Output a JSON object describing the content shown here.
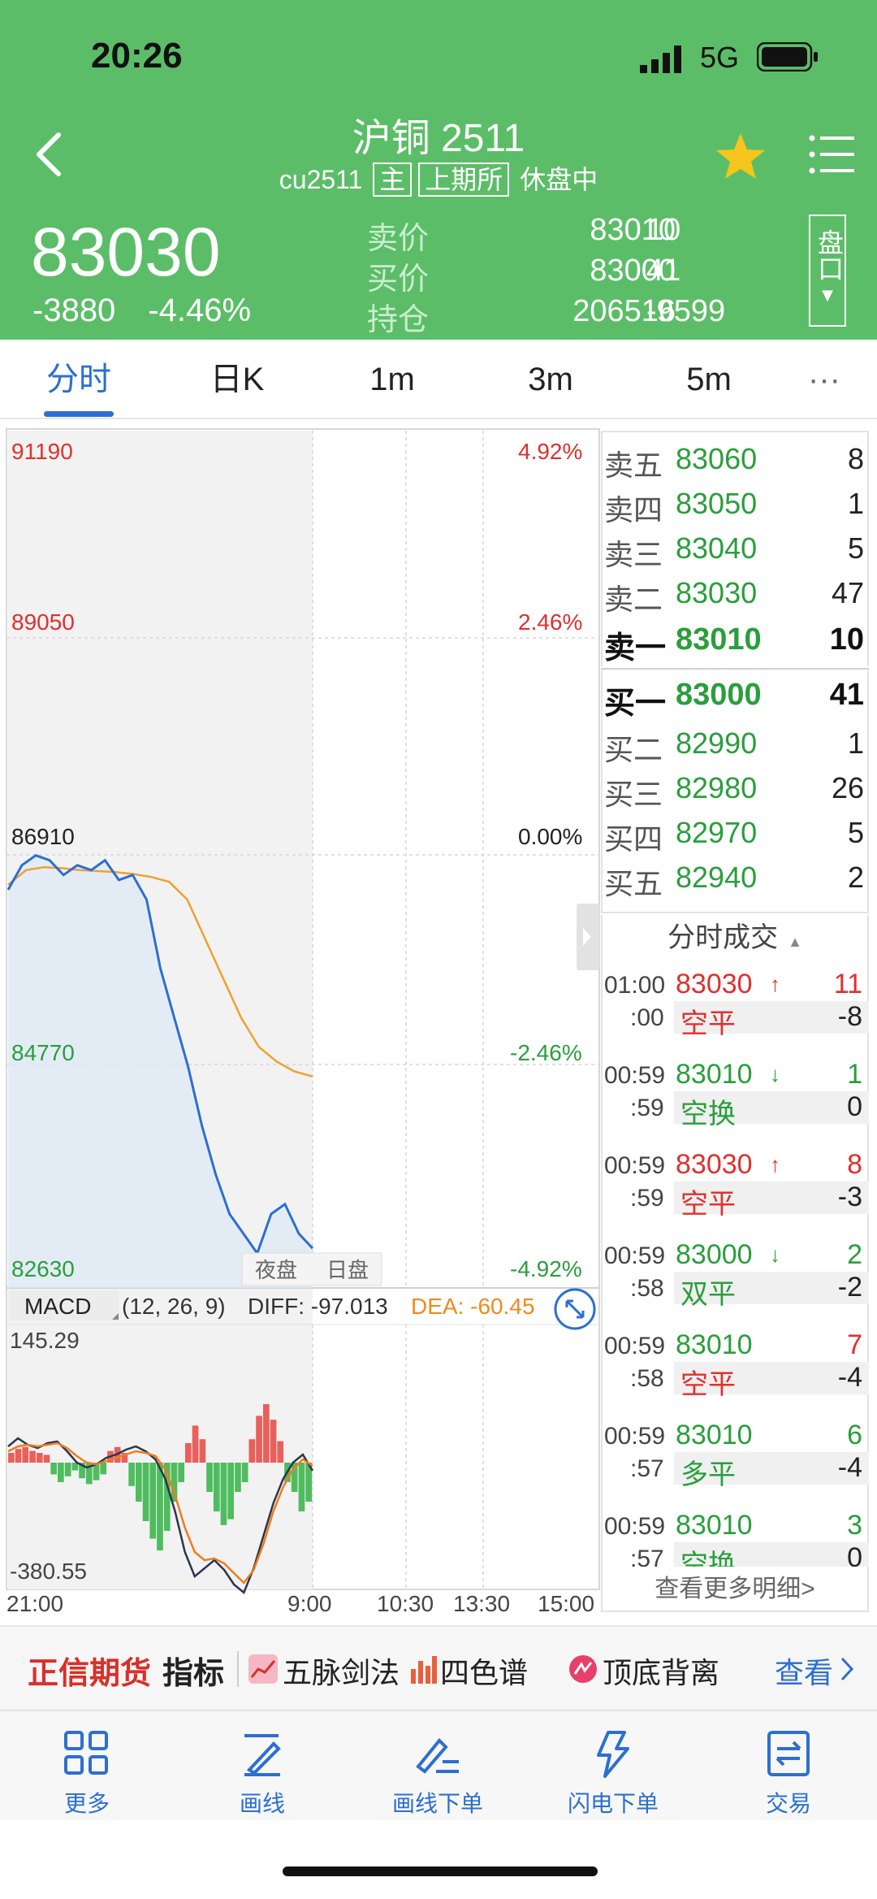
{
  "status_bar": {
    "time": "20:26",
    "network": "5G"
  },
  "header": {
    "title": "沪铜 2511",
    "code": "cu2511",
    "tag_main": "主",
    "tag_exchange": "上期所",
    "session_status": "休盘中",
    "last_price": "83030",
    "change": "-3880",
    "change_pct": "-4.46%",
    "quote": {
      "sell_label": "卖价",
      "sell_price": "83010",
      "sell_qty": "10",
      "buy_label": "买价",
      "buy_price": "83000",
      "buy_qty": "41",
      "oi_label": "持仓",
      "oi_value": "206516",
      "oi_change": "-9599"
    },
    "pankou_label": "盘口"
  },
  "tabs": [
    {
      "label": "分时",
      "active": true
    },
    {
      "label": "日K"
    },
    {
      "label": "1m"
    },
    {
      "label": "3m"
    },
    {
      "label": "5m"
    },
    {
      "label": "···"
    }
  ],
  "chart": {
    "price_axis": [
      "91190",
      "89050",
      "86910",
      "84770",
      "82630"
    ],
    "pct_axis": [
      "4.92%",
      "2.46%",
      "0.00%",
      "-2.46%",
      "-4.92%"
    ],
    "session_labels": [
      "夜盘",
      "日盘"
    ],
    "macd_label": "MACD",
    "macd_params": "(12, 26, 9)",
    "diff": "DIFF: -97.013",
    "dea": "DEA: -60.45",
    "macd_max": "145.29",
    "macd_min": "-380.55",
    "time_axis": [
      "21:00",
      "9:00",
      "10:30",
      "13:30",
      "15:00"
    ]
  },
  "chart_data": {
    "type": "line",
    "title": "",
    "x_range": [
      "21:00",
      "15:00"
    ],
    "ylim": [
      82630,
      91190
    ],
    "series": [
      {
        "name": "",
        "values": [
          86600,
          86850,
          86950,
          86900,
          86750,
          86850,
          86800,
          86900,
          86700,
          86750,
          86500,
          85800,
          85300,
          84800,
          84200,
          83700,
          83300,
          83100,
          82900,
          83300,
          83400,
          83100,
          82950
        ]
      },
      {
        "name": "",
        "values": [
          86650,
          86800,
          86830,
          86820,
          86800,
          86790,
          86780,
          86760,
          86730,
          86680,
          86500,
          86100,
          85700,
          85300,
          85000,
          84850,
          84750,
          84700
        ]
      }
    ]
  },
  "orderbook": {
    "asks": [
      {
        "label": "卖五",
        "price": "83060",
        "qty": "8"
      },
      {
        "label": "卖四",
        "price": "83050",
        "qty": "1"
      },
      {
        "label": "卖三",
        "price": "83040",
        "qty": "5"
      },
      {
        "label": "卖二",
        "price": "83030",
        "qty": "47"
      },
      {
        "label": "卖一",
        "price": "83010",
        "qty": "10"
      }
    ],
    "bids": [
      {
        "label": "买一",
        "price": "83000",
        "qty": "41"
      },
      {
        "label": "买二",
        "price": "82990",
        "qty": "1"
      },
      {
        "label": "买三",
        "price": "82980",
        "qty": "26"
      },
      {
        "label": "买四",
        "price": "82970",
        "qty": "5"
      },
      {
        "label": "买五",
        "price": "82940",
        "qty": "2"
      }
    ]
  },
  "ticks": {
    "title": "分时成交",
    "items": [
      {
        "time": "01:00",
        "sec": ":00",
        "price": "83030",
        "dir": "up",
        "vol": "11",
        "type": "空平",
        "delta": "-8"
      },
      {
        "time": "00:59",
        "sec": ":59",
        "price": "83010",
        "dir": "down",
        "vol": "1",
        "type": "空换",
        "delta": "0"
      },
      {
        "time": "00:59",
        "sec": ":59",
        "price": "83030",
        "dir": "up",
        "vol": "8",
        "type": "空平",
        "delta": "-3"
      },
      {
        "time": "00:59",
        "sec": ":58",
        "price": "83000",
        "dir": "down",
        "vol": "2",
        "type": "双平",
        "delta": "-2"
      },
      {
        "time": "00:59",
        "sec": ":58",
        "price": "83010",
        "dir": "none",
        "vol": "7",
        "type": "空平",
        "delta": "-4"
      },
      {
        "time": "00:59",
        "sec": ":57",
        "price": "83010",
        "dir": "none",
        "vol": "6",
        "type": "多平",
        "delta": "-4"
      },
      {
        "time": "00:59",
        "sec": ":57",
        "price": "83010",
        "dir": "none",
        "vol": "3",
        "type": "空换",
        "delta": "0"
      }
    ],
    "more": "查看更多明细>"
  },
  "promo": {
    "brand": "正信期货",
    "indicator": "指标",
    "items": [
      "五脉剑法",
      "四色谱",
      "顶底背离"
    ],
    "view": "查看"
  },
  "bottom_nav": [
    "更多",
    "画线",
    "画线下单",
    "闪电下单",
    "交易"
  ],
  "colors": {
    "header_green": "#5cbd68",
    "rise_red": "#e0302e",
    "fall_green": "#2a9e3c",
    "accent_blue": "#2c6fd0",
    "avg_line": "#f0a030",
    "price_line": "#2c6fd0"
  }
}
